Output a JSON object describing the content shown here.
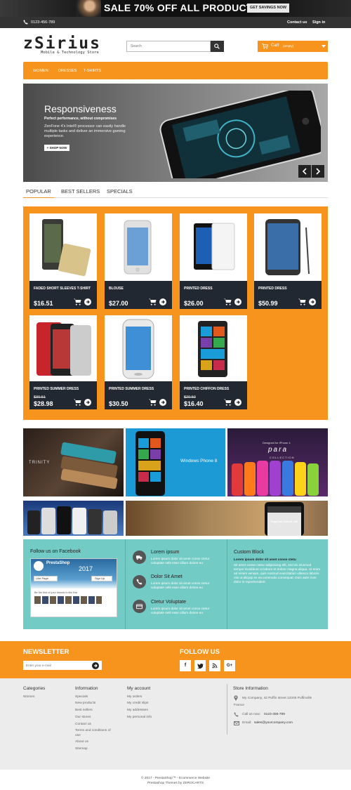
{
  "banner": {
    "text": "SALE 70% OFF ALL PRODUCTS",
    "button": "GET SAVINGS NOW"
  },
  "topbar": {
    "phone": "0123-456-789",
    "contact": "Contact us",
    "signin": "Sign in"
  },
  "header": {
    "logo": "zSirius",
    "tagline": "Mobile & Technology Store",
    "search_placeholder": "Search",
    "cart_label": "Cart",
    "cart_status": "(empty)"
  },
  "menu": [
    "WOMEN",
    "DRESSES",
    "T-SHIRTS"
  ],
  "slider": {
    "title": "Responsiveness",
    "subtitle": "Perfect performance, without compromises",
    "description": "ZenFone 4's Intel® processor can easily handle multiple tasks and deliver an immersive gaming experience.",
    "button": "+ SHOP NOW"
  },
  "tabs": [
    "POPULAR",
    "BEST SELLERS",
    "SPECIALS"
  ],
  "products": [
    {
      "name": "FADED SHORT SLEEVES T-SHIRT",
      "price": "$16.51",
      "old_price": ""
    },
    {
      "name": "BLOUSE",
      "price": "$27.00",
      "old_price": ""
    },
    {
      "name": "PRINTED DRESS",
      "price": "$26.00",
      "old_price": ""
    },
    {
      "name": "PRINTED DRESS",
      "price": "$50.99",
      "old_price": ""
    },
    {
      "name": "PRINTED SUMMER DRESS",
      "price": "$28.98",
      "old_price": "$30.51"
    },
    {
      "name": "PRINTED SUMMER DRESS",
      "price": "$30.50",
      "old_price": ""
    },
    {
      "name": "PRINTED CHIFFON DRESS",
      "price": "$16.40",
      "old_price": "$20.50"
    }
  ],
  "promos": {
    "trinity": "TRINITY",
    "wp8": "Windows Phone 8",
    "para_small": "Designed for iPhone 4",
    "para": "para",
    "para_sub": "COLLECTION",
    "callout": "TrappCall Collect Call"
  },
  "facebook": {
    "title": "Follow us on Facebook",
    "page_name": "PrestaShop",
    "banner_text": "2017",
    "like": "Like Page",
    "signup": "Sign Up",
    "friends": "Be the first of your friends to like this"
  },
  "features": [
    {
      "title": "Lorem ipsum",
      "text": "Lorem ipsum dolor sit amet conse ctetur voluptate velit esse cillum dolore eu"
    },
    {
      "title": "Dolor Sit Amet",
      "text": "Lorem ipsum dolor sit amet conse ctetur voluptate velit esse cillum dolore eu"
    },
    {
      "title": "Ctetur Voluptate",
      "text": "Lorem ipsum dolor sit amet conse ctetur voluptate velit esse cillum dolore eu"
    }
  ],
  "custom_block": {
    "title": "Custom Block",
    "subtitle": "Lorem ipsum dolor sit amet conse ctetu",
    "text": "Sit amet conse ctetur adipisicing elit, sed do eiusmod tempor incididunt ut labore et dolore magna aliqua. Ut enim ad minim veniam, quis nostrud exercitation ullamco laboris nisi ut aliquip ex ea commodo consequat. Duis aute irure dolor in reprehenderit."
  },
  "newsletter": {
    "title": "NEWSLETTER",
    "placeholder": "Enter your e-mail"
  },
  "follow": {
    "title": "FOLLOW US"
  },
  "footer": {
    "categories_title": "Categories",
    "categories": [
      "Women"
    ],
    "information_title": "Information",
    "information": [
      "Specials",
      "New products",
      "Best sellers",
      "Our stores",
      "Contact us",
      "Terms and conditions of",
      "use",
      "About us",
      "Sitemap"
    ],
    "account_title": "My account",
    "account": [
      "My orders",
      "My credit slips",
      "My addresses",
      "My personal info"
    ],
    "store_title": "Store Information",
    "store_address": "My Company, 42 Puffin street 12345 Puffinville",
    "store_country": "France",
    "store_phone_label": "Call us now:",
    "store_phone": "0123-456-789",
    "store_email_label": "Email:",
    "store_email": "sales@yourcompany.com"
  },
  "copyright": {
    "line1": "© 2017 - PrestaShop™ - Ecommerce Website",
    "line2": "Prestashop Themes by ZEROCARTS"
  },
  "colors": {
    "accent": "#f7941d",
    "teal": "#73cbc5",
    "dark": "#333333"
  }
}
